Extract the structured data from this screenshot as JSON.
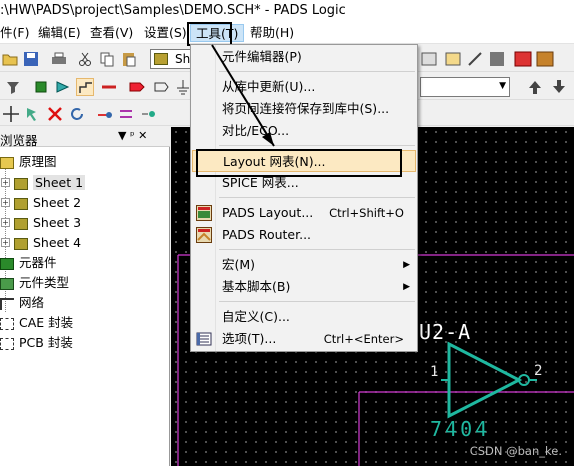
{
  "window": {
    "title": ":\\HW\\PADS\\project\\Samples\\DEMO.SCH* - PADS Logic"
  },
  "menubar": {
    "items": [
      {
        "label": "件(F)"
      },
      {
        "label": "编辑(E)"
      },
      {
        "label": "查看(V)"
      },
      {
        "label": "设置(S)"
      },
      {
        "label": "工具(T)"
      },
      {
        "label": "帮助(H)"
      }
    ]
  },
  "toolbar": {
    "sheet_combo": "She",
    "dropdown_glyph": "▼"
  },
  "panel": {
    "title": "浏览器",
    "pin": "▼ ᵖ ✕",
    "tree": [
      {
        "label": "原理图"
      },
      {
        "label": "Sheet 1"
      },
      {
        "label": "Sheet 2"
      },
      {
        "label": "Sheet 3"
      },
      {
        "label": "Sheet 4"
      },
      {
        "label": "元器件"
      },
      {
        "label": "元件类型"
      },
      {
        "label": "网络"
      },
      {
        "label": "CAE 封装"
      },
      {
        "label": "PCB 封装"
      }
    ]
  },
  "tools_menu": {
    "items": [
      {
        "label": "元件编辑器(P)"
      },
      {
        "label": "从库中更新(U)..."
      },
      {
        "label": "将页间连接符保存到库中(S)..."
      },
      {
        "label": "对比/ECO..."
      },
      {
        "label": "Layout 网表(N)..."
      },
      {
        "label": "SPICE 网表..."
      },
      {
        "label": "PADS Layout...",
        "accel": "Ctrl+Shift+O"
      },
      {
        "label": "PADS Router..."
      },
      {
        "label": "宏(M)"
      },
      {
        "label": "基本脚本(B)"
      },
      {
        "label": "自定义(C)..."
      },
      {
        "label": "选项(T)...",
        "accel": "Ctrl+<Enter>"
      }
    ],
    "submenu_arrow": "▶"
  },
  "schematic": {
    "ref": "U2-A",
    "pin_in": "1",
    "pin_out": "2",
    "part": "7404",
    "colors": {
      "gate": "#1fb8a0",
      "text": "#e8e8e8",
      "net": "#d43bd4",
      "ref_label": "#ffffff"
    }
  },
  "icons": {
    "pads_layout": "pads-layout-icon",
    "pads_router": "pads-router-icon",
    "options": "options-icon"
  },
  "watermark": "CSDN @ban_ke."
}
